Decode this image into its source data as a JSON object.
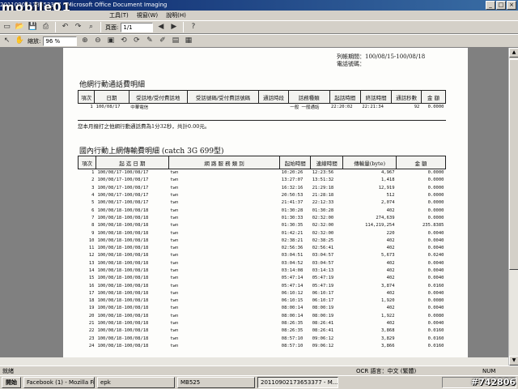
{
  "window": {
    "title": "20110902173653377 - Microsoft Office Document Imaging",
    "watermark_top": "mobile01",
    "controls": [
      "_",
      "□",
      "×"
    ]
  },
  "menu": [
    "工具(T)",
    "視窗(W)",
    "說明(H)"
  ],
  "toolbar": {
    "zoom_label": "縮放:",
    "zoom_value": "96 %",
    "page_label": "頁面:",
    "page_value": "1/1"
  },
  "document": {
    "header_period_label": "列帳期間：",
    "header_period_value": "100/08/15-100/08/18",
    "header_phone_label": "電話號碼：",
    "section1_title": "他網行動通話費明細",
    "section1_headers": [
      "項次",
      "日期",
      "受話地/受付費話地",
      "受話號碼/受付費話號碼",
      "通話時段",
      "話務種類",
      "起話時間",
      "終話時間",
      "通話秒數",
      "金 額"
    ],
    "section1_row": [
      "1",
      "100/08/17",
      "中華電信",
      "",
      "",
      "一般",
      "一般通話",
      "22:20:02",
      "22:21:34",
      "92",
      "0.0000"
    ],
    "section1_note": "您本月撥打之他網行動通話費為1分32秒，共計0.00元。",
    "section2_title": "國內行動上網傳輸費明細 (catch 3G 699型)",
    "section2_headers": [
      "項次",
      "起 迄 日 期",
      "網 路 服 務 類 別",
      "起始時間",
      "連線時間",
      "傳輸量(byte)",
      "金 額"
    ],
    "section2_rows": [
      [
        "1",
        "100/08/17-100/08/17",
        "twn",
        "10:20:26",
        "12:23:56",
        "4,967",
        "0.0000"
      ],
      [
        "2",
        "100/08/17-100/08/17",
        "twn",
        "13:27:07",
        "13:51:32",
        "1,418",
        "0.0000"
      ],
      [
        "3",
        "100/08/17-100/08/17",
        "twn",
        "16:32:16",
        "21:29:18",
        "12,919",
        "0.0000"
      ],
      [
        "4",
        "100/08/17-100/08/17",
        "twn",
        "20:50:53",
        "21:28:18",
        "512",
        "0.0000"
      ],
      [
        "5",
        "100/08/17-100/08/17",
        "twn",
        "21:41:37",
        "22:12:33",
        "2,074",
        "0.0000"
      ],
      [
        "6",
        "100/08/18-100/08/18",
        "twn",
        "01:30:28",
        "01:30:28",
        "402",
        "0.0000"
      ],
      [
        "7",
        "100/08/18-100/08/18",
        "twn",
        "01:30:33",
        "02:32:00",
        "274,639",
        "0.0000"
      ],
      [
        "8",
        "100/08/18-100/08/18",
        "twn",
        "01:30:35",
        "02:32:00",
        "114,219,254",
        "235.8385"
      ],
      [
        "9",
        "100/08/18-100/08/18",
        "twn",
        "01:42:21",
        "02:32:00",
        "220",
        "0.0040"
      ],
      [
        "10",
        "100/08/18-100/08/18",
        "twn",
        "02:38:21",
        "02:38:25",
        "402",
        "0.0040"
      ],
      [
        "11",
        "100/08/18-100/08/18",
        "twn",
        "02:56:36",
        "02:56:41",
        "402",
        "0.0040"
      ],
      [
        "12",
        "100/08/18-100/08/18",
        "twn",
        "03:04:51",
        "03:04:57",
        "5,673",
        "0.0240"
      ],
      [
        "13",
        "100/08/18-100/08/18",
        "twn",
        "03:04:52",
        "03:04:57",
        "402",
        "0.0040"
      ],
      [
        "14",
        "100/08/18-100/08/18",
        "twn",
        "03:14:08",
        "03:14:13",
        "402",
        "0.0040"
      ],
      [
        "15",
        "100/08/18-100/08/18",
        "twn",
        "05:47:14",
        "05:47:19",
        "402",
        "0.0040"
      ],
      [
        "16",
        "100/08/18-100/08/18",
        "twn",
        "05:47:14",
        "05:47:19",
        "3,874",
        "0.0160"
      ],
      [
        "17",
        "100/08/18-100/08/18",
        "twn",
        "06:10:12",
        "06:10:17",
        "402",
        "0.0040"
      ],
      [
        "18",
        "100/08/18-100/08/18",
        "twn",
        "06:10:15",
        "06:10:17",
        "1,920",
        "0.0080"
      ],
      [
        "19",
        "100/08/18-100/08/18",
        "twn",
        "08:00:14",
        "08:00:19",
        "402",
        "0.0040"
      ],
      [
        "20",
        "100/08/18-100/08/18",
        "twn",
        "08:00:14",
        "08:00:19",
        "1,922",
        "0.0080"
      ],
      [
        "21",
        "100/08/18-100/08/18",
        "twn",
        "08:26:35",
        "08:26:41",
        "402",
        "0.0040"
      ],
      [
        "22",
        "100/08/18-100/08/18",
        "twn",
        "08:26:35",
        "08:26:41",
        "3,868",
        "0.0160"
      ],
      [
        "23",
        "100/08/18-100/08/18",
        "twn",
        "08:57:10",
        "09:06:12",
        "3,829",
        "0.0160"
      ],
      [
        "24",
        "100/08/18-100/08/18",
        "twn",
        "08:57:10",
        "09:06:12",
        "3,866",
        "0.0160"
      ]
    ]
  },
  "status": {
    "left": "就緒",
    "ocr": "OCR 語言：中文 (繁體)",
    "num": "NUM"
  },
  "taskbar": {
    "start": "開始",
    "items": [
      "Facebook (1) - Mozilla Fir...",
      "epk",
      "MB525",
      "20110902173653377 - M..."
    ],
    "watermark": "#742806"
  }
}
